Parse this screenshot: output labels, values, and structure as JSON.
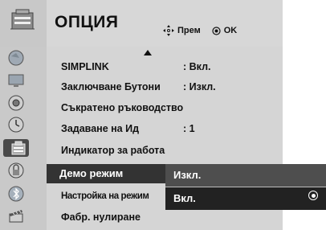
{
  "header": {
    "title": "ОПЦИЯ",
    "hint_move": "Прем",
    "hint_ok": "OK"
  },
  "sidebar": {
    "icons": [
      "picture-icon",
      "tv-icon",
      "speaker-icon",
      "clock-icon",
      "lock-icon",
      "option-icon",
      "bluetooth-icon",
      "clapper-icon"
    ],
    "selected": "option-icon"
  },
  "menu": {
    "items": [
      {
        "label": "SIMPLINK",
        "value": ": Вкл."
      },
      {
        "label": "Заключване Бутони",
        "value": ": Изкл."
      },
      {
        "label": "Съкратено ръководство",
        "value": ""
      },
      {
        "label": "Задаване на Ид",
        "value": ": 1"
      },
      {
        "label": "Индикатор за работа",
        "value": ""
      },
      {
        "label": "Демо режим",
        "value": ""
      },
      {
        "label": "Настройка на режим",
        "value": ""
      },
      {
        "label": "Фабр. нулиране",
        "value": ""
      }
    ],
    "selected_index": 5
  },
  "popup": {
    "options": [
      "Изкл.",
      "Вкл."
    ],
    "selected": "Вкл."
  }
}
